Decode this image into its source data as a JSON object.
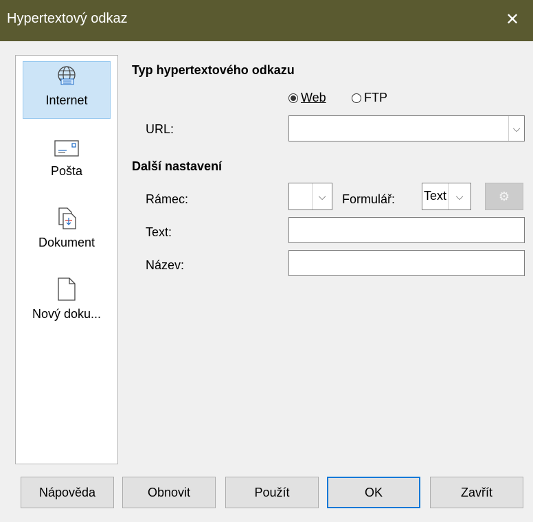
{
  "window": {
    "title": "Hypertextový odkaz",
    "close_glyph": "✕"
  },
  "sidebar": {
    "items": [
      {
        "label": "Internet",
        "icon": "globe-icon",
        "selected": true
      },
      {
        "label": "Pošta",
        "icon": "mail-icon"
      },
      {
        "label": "Dokument",
        "icon": "document-icon"
      },
      {
        "label": "Nový doku...",
        "icon": "new-document-icon"
      }
    ]
  },
  "hyperlink_type": {
    "heading": "Typ hypertextového odkazu",
    "radio_web": {
      "label": "Web",
      "selected": true
    },
    "radio_ftp": {
      "label": "FTP",
      "selected": false
    },
    "url_label": "URL:",
    "url_value": ""
  },
  "further_settings": {
    "heading": "Další nastavení",
    "frame_label": "Rámec:",
    "frame_value": "",
    "form_label": "Formulář:",
    "form_value": "Text",
    "text_label": "Text:",
    "text_value": "",
    "name_label": "Název:",
    "name_value": ""
  },
  "buttons": {
    "help": "Nápověda",
    "reset": "Obnovit",
    "apply": "Použít",
    "ok": "OK",
    "close": "Zavřít"
  }
}
